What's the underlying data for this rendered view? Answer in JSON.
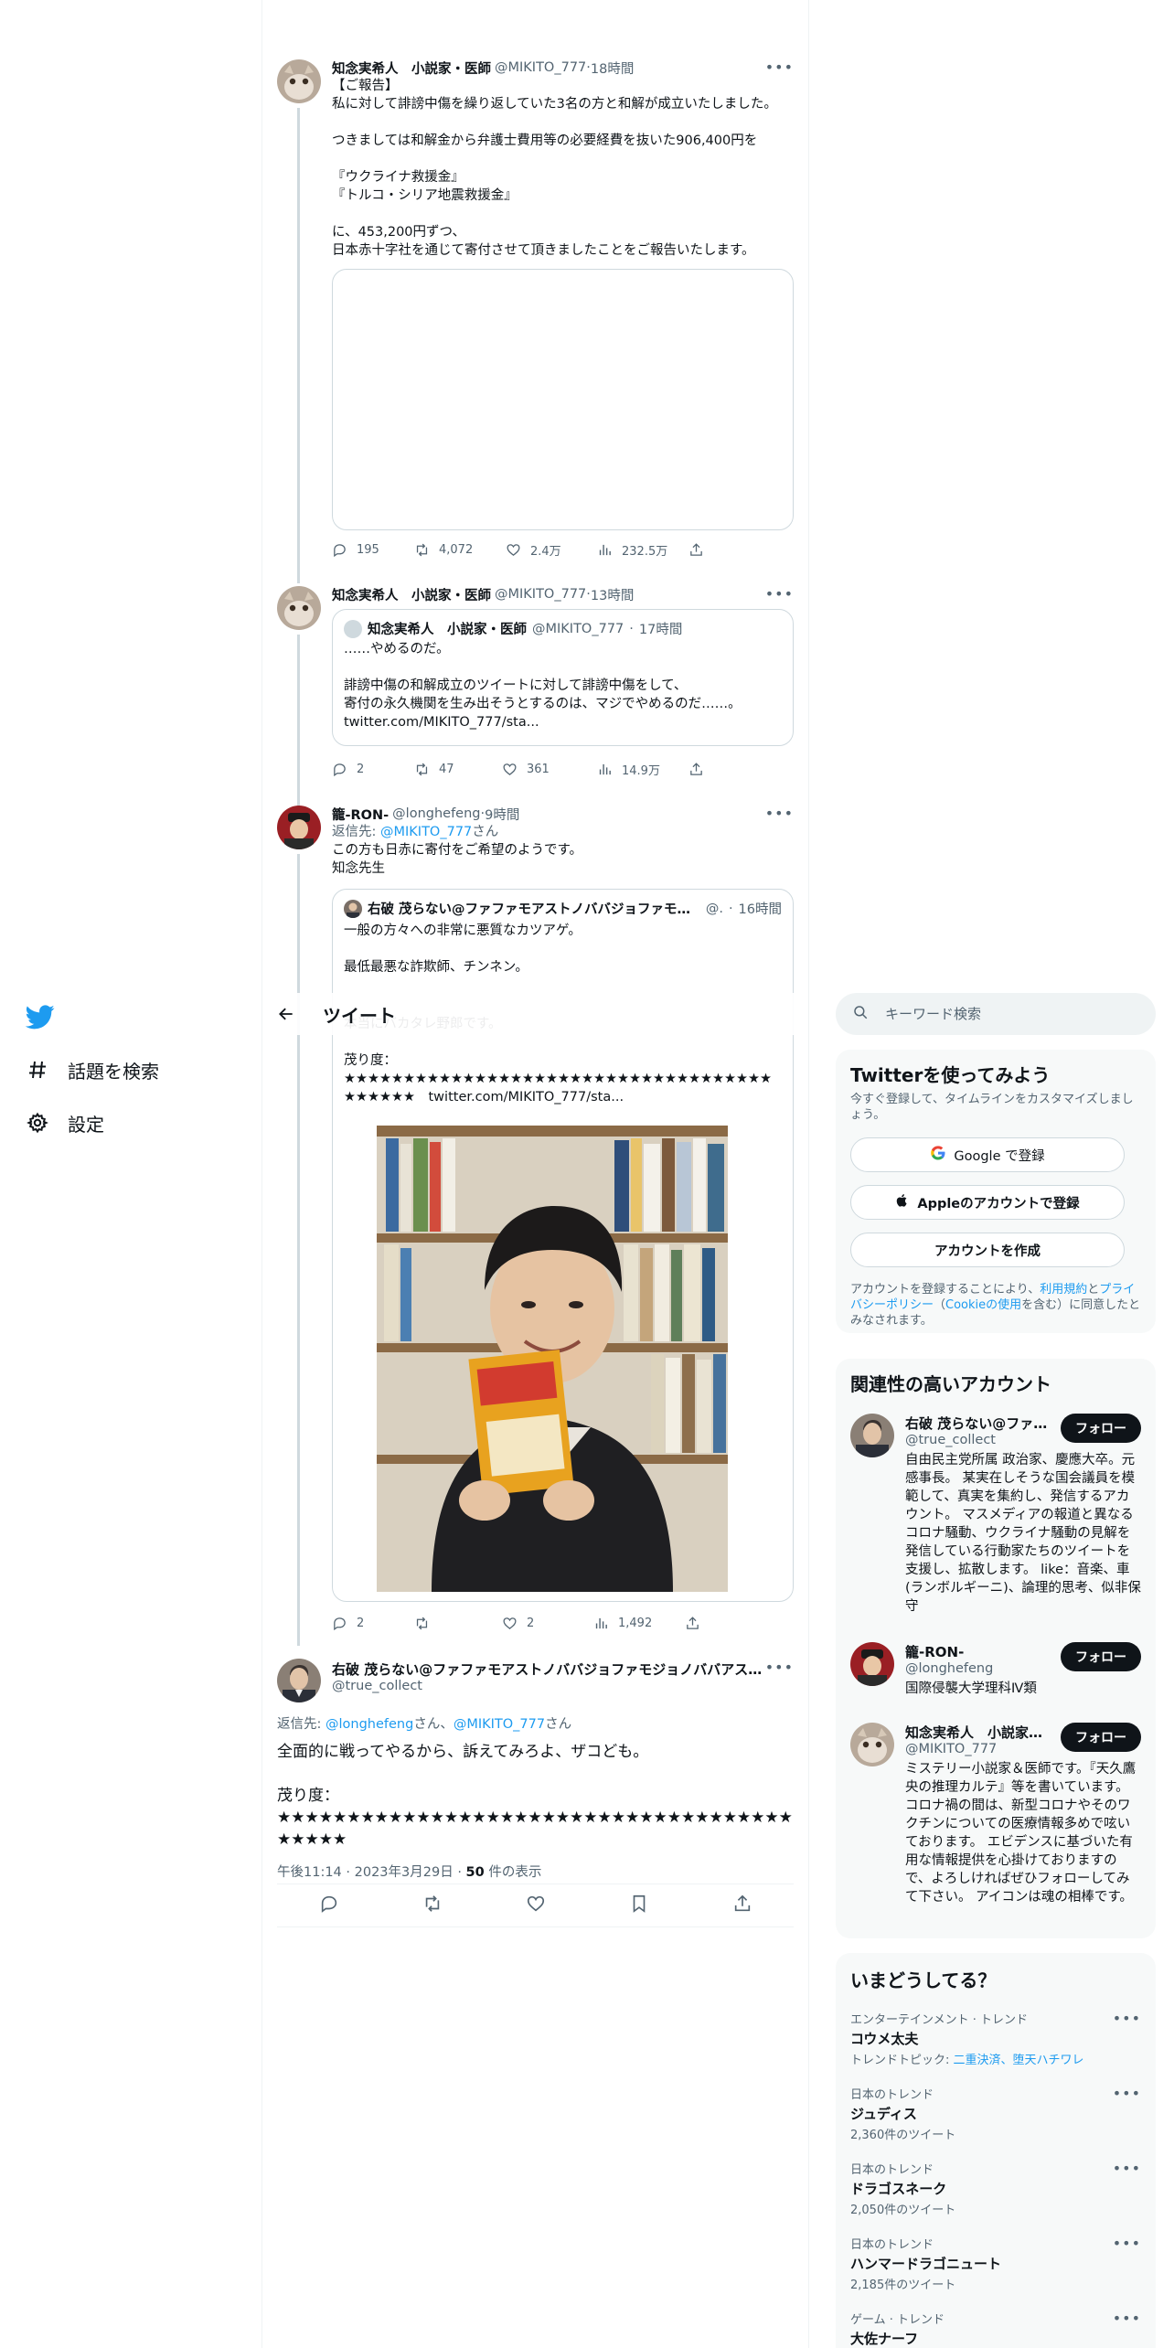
{
  "nav": {
    "items": [
      {
        "label": "話題を検索",
        "icon": "hashtag-icon"
      },
      {
        "label": "設定",
        "icon": "gear-icon"
      }
    ]
  },
  "header": {
    "title": "ツイート"
  },
  "tweets": [
    {
      "name": "知念実希人　小説家・医師",
      "handle": "@MIKITO_777",
      "dot": "·",
      "time": "18時間",
      "text": "【ご報告】\n私に対して誹謗中傷を繰り返していた3名の方と和解が成立いたしました。\n\nつきましては和解金から弁護士費用等の必要経費を抜いた906,400円を\n\n『ウクライナ救援金』\n『トルコ・シリア地震救援金』\n\nに、453,200円ずつ、\n日本赤十字社を通じて寄付させて頂きましたことをご報告いたします。",
      "replies": "195",
      "retweets": "4,072",
      "likes": "2.4万",
      "views": "232.5万"
    },
    {
      "name": "知念実希人　小説家・医師",
      "handle": "@MIKITO_777",
      "dot": "·",
      "time": "13時間",
      "quote": {
        "name": "知念実希人　小説家・医師",
        "handle": "@MIKITO_777",
        "dot": "·",
        "time": "17時間",
        "text": "……やめるのだ。\n\n誹謗中傷の和解成立のツイートに対して誹謗中傷をして、\n寄付の永久機関を生み出そうとするのは、マジでやめるのだ……。\ntwitter.com/MIKITO_777/sta..."
      },
      "replies": "2",
      "retweets": "47",
      "likes": "361",
      "views": "14.9万"
    },
    {
      "name": "籠-RON-",
      "handle": "@longhefeng",
      "dot": "·",
      "time": "9時間",
      "reply_prefix": "返信先: ",
      "reply_to": "@MIKITO_777",
      "reply_suffix": "さん",
      "text": "この方も日赤に寄付をご希望のようです。\n知念先生",
      "quote": {
        "name": "右破 茂らない@ファファモアストノババジョファモ…",
        "handle": "@.",
        "dot": "·",
        "time": "16時間",
        "text": "一般の方々への非常に悪質なカツアゲ。\n\n最低最悪な詐欺師、チンネン。",
        "text2": "本当にバカタレ野郎です。\n\n茂り度：\n★★★★★★★★★★★★★★★★★★★★★★★★★★★★★★★★★★★★★★★★★★　twitter.com/MIKITO_777/sta..."
      },
      "replies": "2",
      "retweets": "",
      "likes": "2",
      "views": "1,492"
    }
  ],
  "focused": {
    "name": "右破 茂らない@ファファモアストノババジョファモジョノババアス…",
    "handle": "@true_collect",
    "reply_prefix": "返信先: ",
    "reply_to_1": "@longhefeng",
    "reply_mid": "さん、",
    "reply_to_2": "@MIKITO_777",
    "reply_suffix": "さん",
    "text": "全面的に戦ってやるから、訴えてみろよ、ザコども。\n\n茂り度：\n★★★★★★★★★★★★★★★★★★★★★★★★★★★★★★★★★★★★★★★★★★",
    "time": "午後11:14",
    "dot": "·",
    "date": "2023年3月29日",
    "dot2": "·",
    "views_num": "50",
    "views_label": " 件の表示"
  },
  "search": {
    "placeholder": "キーワード検索"
  },
  "signup": {
    "title": "Twitterを使ってみよう",
    "subtitle": "今すぐ登録して、タイムラインをカスタマイズしましょう。",
    "google": "Google で登録",
    "apple": "Appleのアカウントで登録",
    "create": "アカウントを作成",
    "legal_1": "アカウントを登録することにより、",
    "legal_terms": "利用規約",
    "legal_2": "と",
    "legal_privacy": "プライバシーポリシー",
    "legal_3": "（",
    "legal_cookie": "Cookieの使用",
    "legal_4": "を含む）に同意したとみなされます。"
  },
  "related": {
    "title": "関連性の高いアカウント",
    "follow_label": "フォロー",
    "accounts": [
      {
        "name": "右破 茂らない@ファ…",
        "handle": "@true_collect",
        "bio": "自由民主党所属 政治家、慶應大卒。元感事長。 某実在しそうな国会議員を模範して、真実を集約し、発信するアカウント。 マスメディアの報道と異なるコロナ騒動、ウクライナ騒動の見解を発信している行動家たちのツイートを支援し、拡散します。 like：音楽、車(ランボルギーニ)、論理的思考、似非保守"
      },
      {
        "name": "籠-RON-",
        "handle": "@longhefeng",
        "bio": "国際侵襲大学理科Ⅳ類"
      },
      {
        "name": "知念実希人　小説家…",
        "handle": "@MIKITO_777",
        "bio": "ミステリー小説家＆医師です。『天久鷹央の推理カルテ』等を書いています。 コロナ禍の間は、新型コロナやそのワクチンについての医療情報多めで呟いております。 エビデンスに基づいた有用な情報提供を心掛けておりますので、よろしければぜひフォローしてみて下さい。 アイコンは魂の相棒です。"
      }
    ]
  },
  "trends": {
    "title": "いまどうしてる？",
    "items": [
      {
        "category": "エンターテインメント · トレンド",
        "name": "コウメ太夫",
        "extra_label": "トレンドトピック: ",
        "extra_link": "二重決済、堕天ハチワレ"
      },
      {
        "category": "日本のトレンド",
        "name": "ジュディス",
        "count": "2,360件のツイート"
      },
      {
        "category": "日本のトレンド",
        "name": "ドラゴスネーク",
        "count": "2,050件のツイート"
      },
      {
        "category": "日本のトレンド",
        "name": "ハンマードラゴニュート",
        "count": "2,185件のツイート"
      },
      {
        "category": "ゲーム · トレンド",
        "name": "大佐ナーフ"
      }
    ]
  },
  "colors": {
    "accent": "#1d9bf0",
    "text": "#0f1419",
    "secondary": "#536471",
    "border": "#cfd9de",
    "panel": "#f7f9f9"
  }
}
